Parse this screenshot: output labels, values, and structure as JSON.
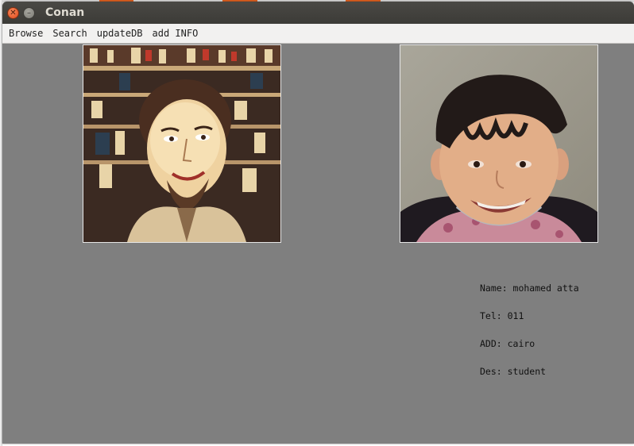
{
  "window": {
    "title": "Conan"
  },
  "menu": {
    "items": [
      "Browse",
      "Search",
      "updateDB",
      "add INFO"
    ]
  },
  "images": {
    "query": {
      "icon": "stylized-portrait-image",
      "description_name": "query-photo"
    },
    "match": {
      "icon": "child-portrait-image",
      "description_name": "match-photo"
    }
  },
  "info": {
    "name": "Name: mohamed atta",
    "tel": "Tel: 011",
    "add": "ADD: cairo",
    "des": "Des: student"
  },
  "colors": {
    "panel_bg": "#7f7f7f",
    "titlebar_bg": "#3c3b37",
    "close_button": "#e0491c",
    "menubar_bg": "#f2f1f0"
  }
}
